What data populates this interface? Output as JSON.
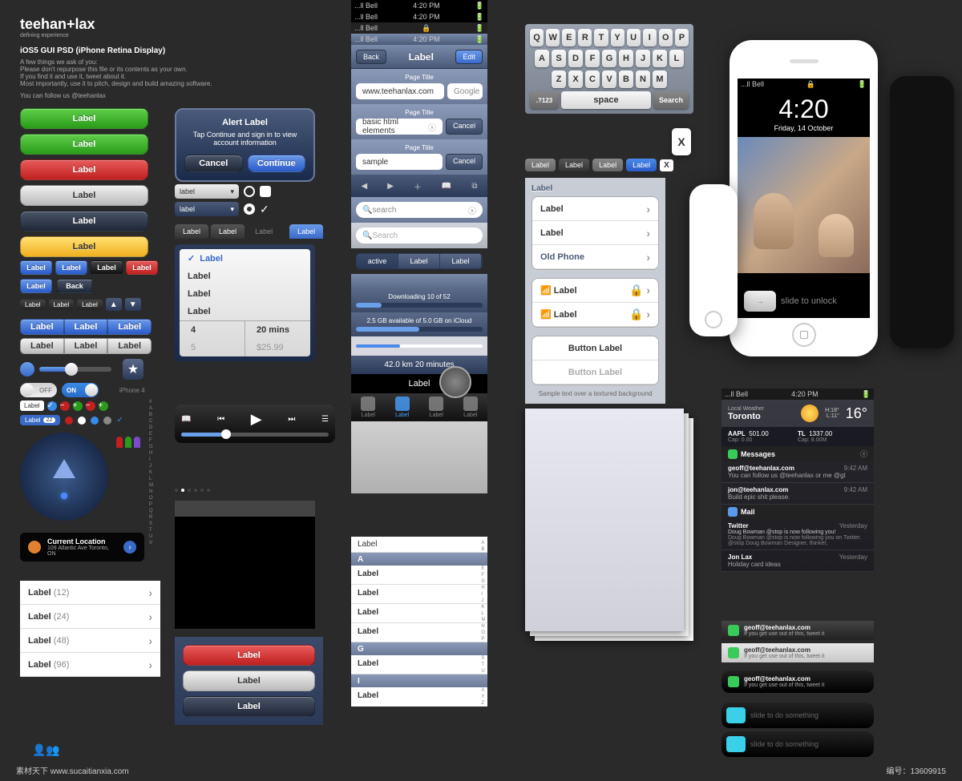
{
  "header": {
    "brand": "teehan+lax",
    "tagline": "defining experience",
    "title": "iOS5 GUI PSD (iPhone Retina Display)",
    "line1": "A few things we ask of you:",
    "line2": "Please don't repurpose this file or its contents as your own.",
    "line3": "If you find it and use it, tweet about it.",
    "line4": "Most importantly, use it to pitch, design and build amazing software.",
    "line5": "You can follow us @teehanlax"
  },
  "buttons": {
    "label": "Label",
    "back": "Back",
    "edit": "Edit",
    "cancel": "Cancel",
    "continue": "Continue",
    "google": "Google",
    "buttonLabel": "Button Label"
  },
  "alert": {
    "title": "Alert Label",
    "body": "Tap Continue and sign in to view account information"
  },
  "dropdown": {
    "value": "label"
  },
  "picker": {
    "item": "Label",
    "num": "4",
    "time": "20 mins"
  },
  "tabs": {
    "label": "Label",
    "active": "active"
  },
  "statusbar": {
    "carrier": "...ll Bell",
    "time": "4:20 PM",
    "lock": "🔒"
  },
  "nav": {
    "pageTitle": "Page Title",
    "url": "www.teehanlax.com",
    "query": "basic html elements",
    "sample": "sample",
    "search": "search",
    "Search": "Search"
  },
  "progress": {
    "download": "Downloading 10 of 52",
    "icloud": "2.5 GB available of 5.0 GB on iCloud",
    "route": "42.0 km 20 minutes"
  },
  "list": {
    "oldPhone": "Old Phone",
    "sample": "Sample text over a textured background"
  },
  "counts": [
    "(12)",
    "(24)",
    "(48)",
    "(96)"
  ],
  "location": {
    "title": "Current Location",
    "addr": "109 Atlantic Ave Toronto, ON"
  },
  "iphone4": "iPhone 4",
  "keyboard": {
    "r1": [
      "Q",
      "W",
      "E",
      "R",
      "T",
      "Y",
      "U",
      "I",
      "O",
      "P"
    ],
    "r2": [
      "A",
      "S",
      "D",
      "F",
      "G",
      "H",
      "J",
      "K",
      "L"
    ],
    "r3": [
      "Z",
      "X",
      "C",
      "V",
      "B",
      "N",
      "M"
    ],
    "shift": ".?123",
    "space": "space",
    "search": "Search",
    "x": "X"
  },
  "lockscreen": {
    "time": "4:20",
    "date": "Friday, 14 October",
    "slide": "slide to unlock"
  },
  "slider": {
    "something": "slide to do something"
  },
  "weather": {
    "loc": "Local Weather",
    "city": "Toronto",
    "temp": "16°",
    "hi": "H:18°",
    "lo": "L:11°"
  },
  "stocks": {
    "s1": "AAPL",
    "v1": "501.00",
    "c1": "Cap: 0.00",
    "s2": "TL",
    "v2": "1337.00",
    "c2": "Cap: 8.00M"
  },
  "notif": {
    "messages": "Messages",
    "m1": "geoff@teehanlax.com",
    "m1b": "You can follow us @teehanlax or me @gt",
    "m1t": "9:42 AM",
    "m2": "jon@teehanlax.com",
    "m2b": "Build epic shit please.",
    "m2t": "9:42 AM",
    "mail": "Mail",
    "tw": "Twitter",
    "twb": "Doug Bowman @stop is now following you!",
    "twb2": "Doug Bowman @stop is now following you on Twitter. @stop Doug Bowman Designer, thinker,",
    "twt": "Yesterday",
    "j": "Jon Lax",
    "jb": "Holiday card ideas",
    "jt": "Yesterday",
    "toast": "geoff@teehanlax.com",
    "toastb": "If you get use out of this, tweet it"
  },
  "toggles": {
    "off": "OFF",
    "on": "ON"
  },
  "badge": "22",
  "alpha": [
    "A",
    "B",
    "C",
    "D",
    "E",
    "F",
    "G",
    "H",
    "I"
  ],
  "footer": {
    "site": "素材天下 www.sucaitianxia.com",
    "id": "编号：13609915"
  }
}
